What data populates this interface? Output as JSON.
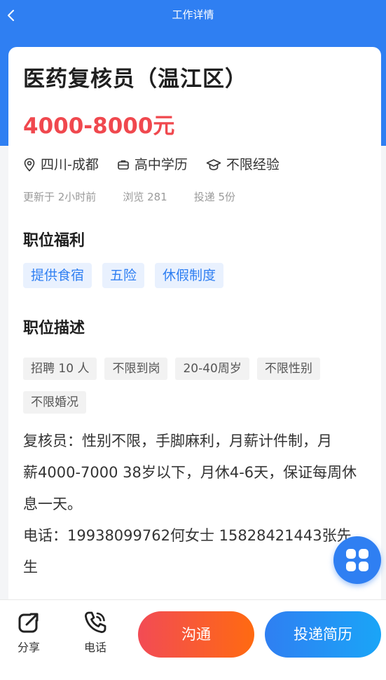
{
  "nav": {
    "title": "工作详情",
    "back_icon": "chevron-left-icon"
  },
  "job": {
    "title": "医药复核员（温江区）",
    "salary": "4000-8000元",
    "location": "四川-成都",
    "education": "高中学历",
    "experience": "不限经验",
    "updated": "更新于 2小时前",
    "views": "浏览 281",
    "applications": "投递 5份"
  },
  "benefits": {
    "title": "职位福利",
    "tags": [
      "提供食宿",
      "五险",
      "休假制度"
    ]
  },
  "description": {
    "title": "职位描述",
    "tags": [
      "招聘 10 人",
      "不限到岗",
      "20-40周岁",
      "不限性别",
      "不限婚况"
    ],
    "lines": [
      "复核员：性别不限，手脚麻利，月薪计件制，月",
      "薪4000-7000 38岁以下，月休4-6天，保证每周休",
      "息一天。",
      "电话：19938099762何女士 15828421443张先",
      "生"
    ]
  },
  "bottom_bar": {
    "share_label": "分享",
    "phone_label": "电话",
    "chat_label": "沟通",
    "apply_label": "投递简历"
  },
  "colors": {
    "primary": "#2f7ff2",
    "salary": "#f0484e",
    "chat_gradient_start": "#f24b55",
    "chat_gradient_end": "#ff6a11"
  },
  "icons": {
    "location": "location-pin-icon",
    "education": "briefcase-icon",
    "experience": "graduation-cap-icon",
    "share": "share-icon",
    "phone": "phone-icon",
    "float": "grid-menu-icon"
  }
}
